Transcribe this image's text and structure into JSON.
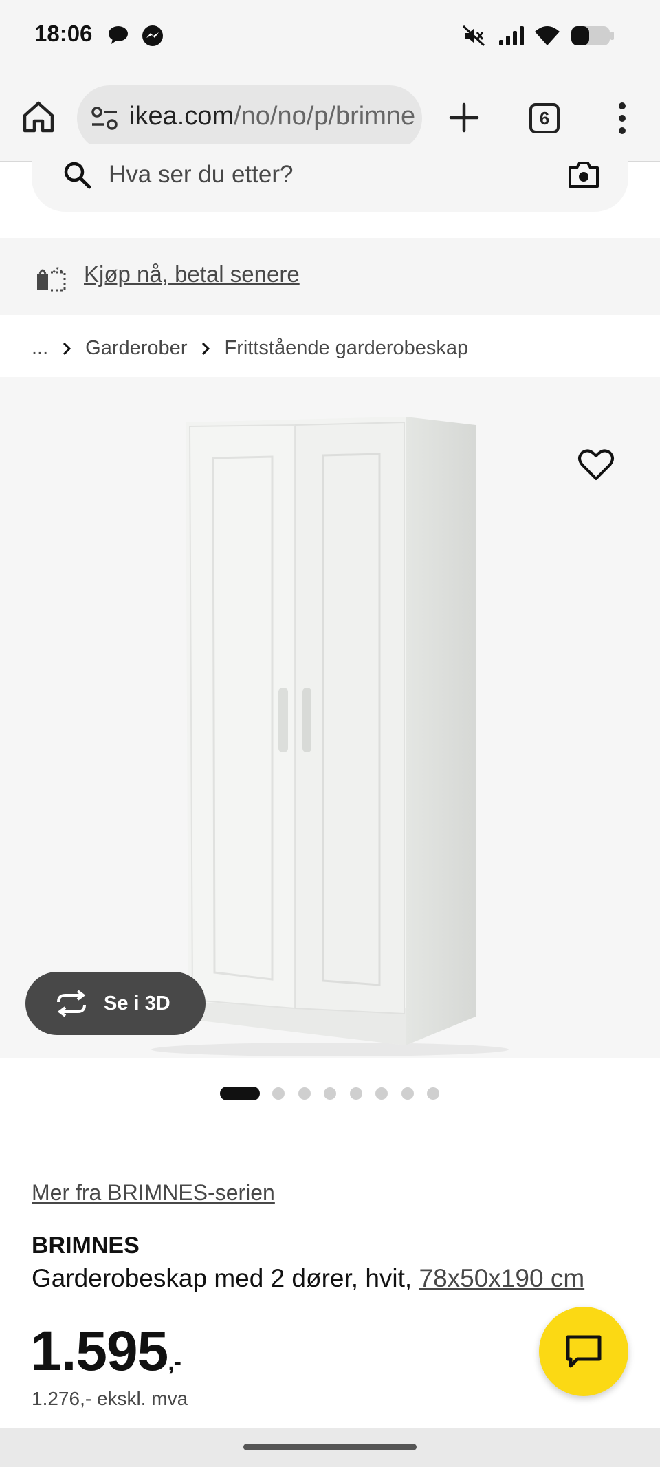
{
  "status_bar": {
    "time": "18:06",
    "icons": [
      "chat-bubble-icon",
      "messenger-icon",
      "mute-icon",
      "signal-icon",
      "wifi-icon",
      "battery-icon"
    ]
  },
  "browser": {
    "url_host": "ikea.com",
    "url_path": "/no/no/p/brimne",
    "tab_count": "6",
    "icons": [
      "home-icon",
      "site-settings-icon",
      "plus-icon",
      "more-vert-icon"
    ]
  },
  "search": {
    "placeholder": "Hva ser du etter?",
    "icons": [
      "search-icon",
      "camera-icon"
    ]
  },
  "pay_later": {
    "label": "Kjøp nå, betal senere",
    "icon": "shopping-bag-icon"
  },
  "breadcrumb": {
    "items": [
      "...",
      "Garderober",
      "Frittstående garderobeskap"
    ]
  },
  "product_media": {
    "see_3d_label": "Se i 3D",
    "carousel_total": 8,
    "carousel_active": 1,
    "icons": [
      "heart-icon",
      "rotate-3d-icon"
    ]
  },
  "product": {
    "series_link": "Mer fra BRIMNES-serien",
    "name": "BRIMNES",
    "description": "Garderobeskap med 2 dører, hvit,",
    "dimensions": "78x50x190 cm",
    "price": "1.595",
    "price_suffix": ",-",
    "price_ex_vat": "1.276,- ekskl. mva"
  },
  "colors": {
    "brand_yellow": "#fbd914",
    "text_dark": "#111111",
    "text_grey": "#484848",
    "surface": "#f5f5f5"
  }
}
